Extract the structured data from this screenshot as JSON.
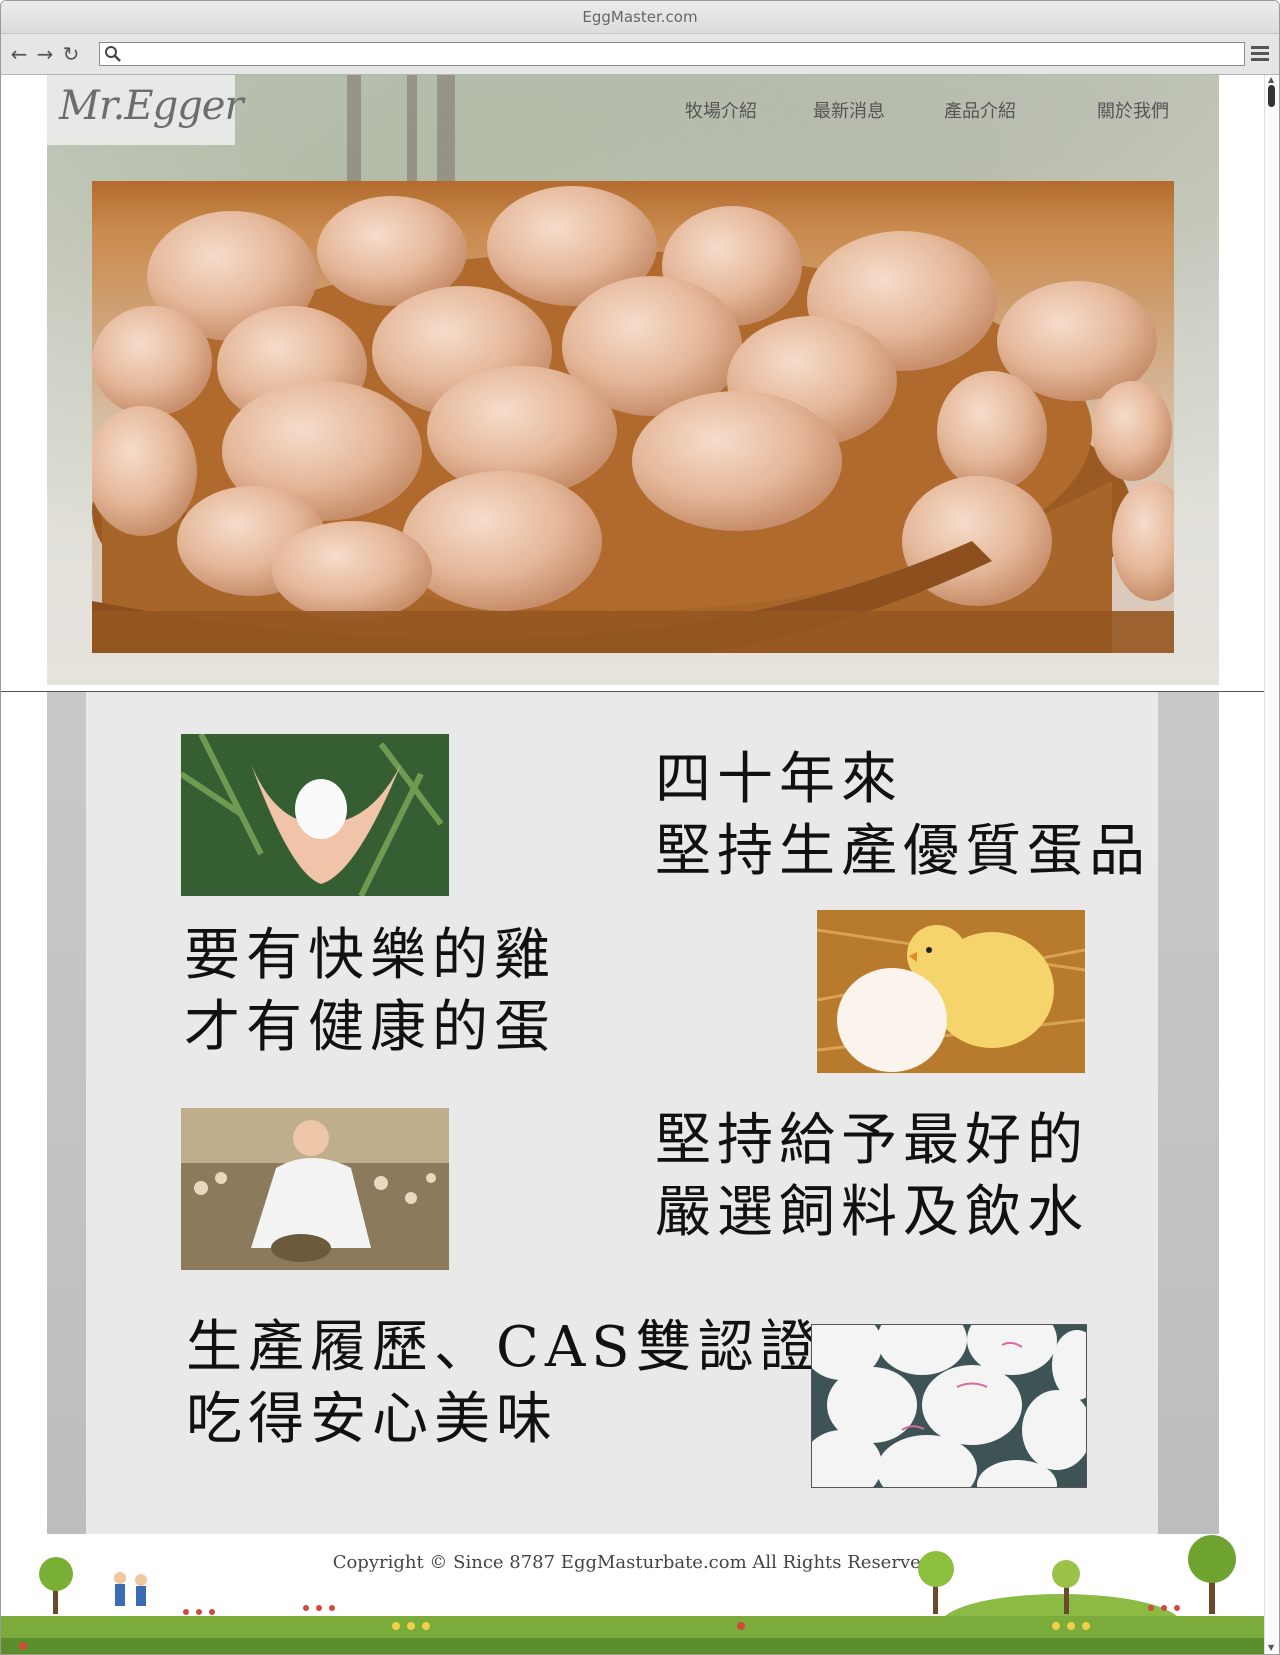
{
  "browser": {
    "title": "EggMaster.com",
    "url_value": "",
    "back_icon": "back-arrow-icon",
    "forward_icon": "forward-arrow-icon",
    "reload_icon": "reload-icon",
    "menu_icon": "hamburger-menu-icon"
  },
  "site": {
    "logo": "Mr.Egger",
    "nav": [
      {
        "label": "牧場介紹"
      },
      {
        "label": "最新消息"
      },
      {
        "label": "產品介紹"
      },
      {
        "label": "關於我們"
      }
    ]
  },
  "features": [
    {
      "line1": "四十年來",
      "line2": "堅持生產優質蛋品",
      "image": "hands-holding-egg"
    },
    {
      "line1": "要有快樂的雞",
      "line2": "才有健康的蛋",
      "image": "chick-with-egg"
    },
    {
      "line1": "堅持給予最好的",
      "line2": "嚴選飼料及飲水",
      "image": "farmer-in-chicken-house"
    },
    {
      "line1": "生產履歷、CAS雙認證",
      "line2": "吃得安心美味",
      "image": "stamped-eggs-in-tray"
    }
  ],
  "footer": {
    "copyright": "Copyright © Since 8787 EggMasturbate.com All Rights Reserved"
  },
  "colors": {
    "nav_text": "#555555",
    "feature_text": "#111111",
    "grass": "#7bab3a"
  }
}
